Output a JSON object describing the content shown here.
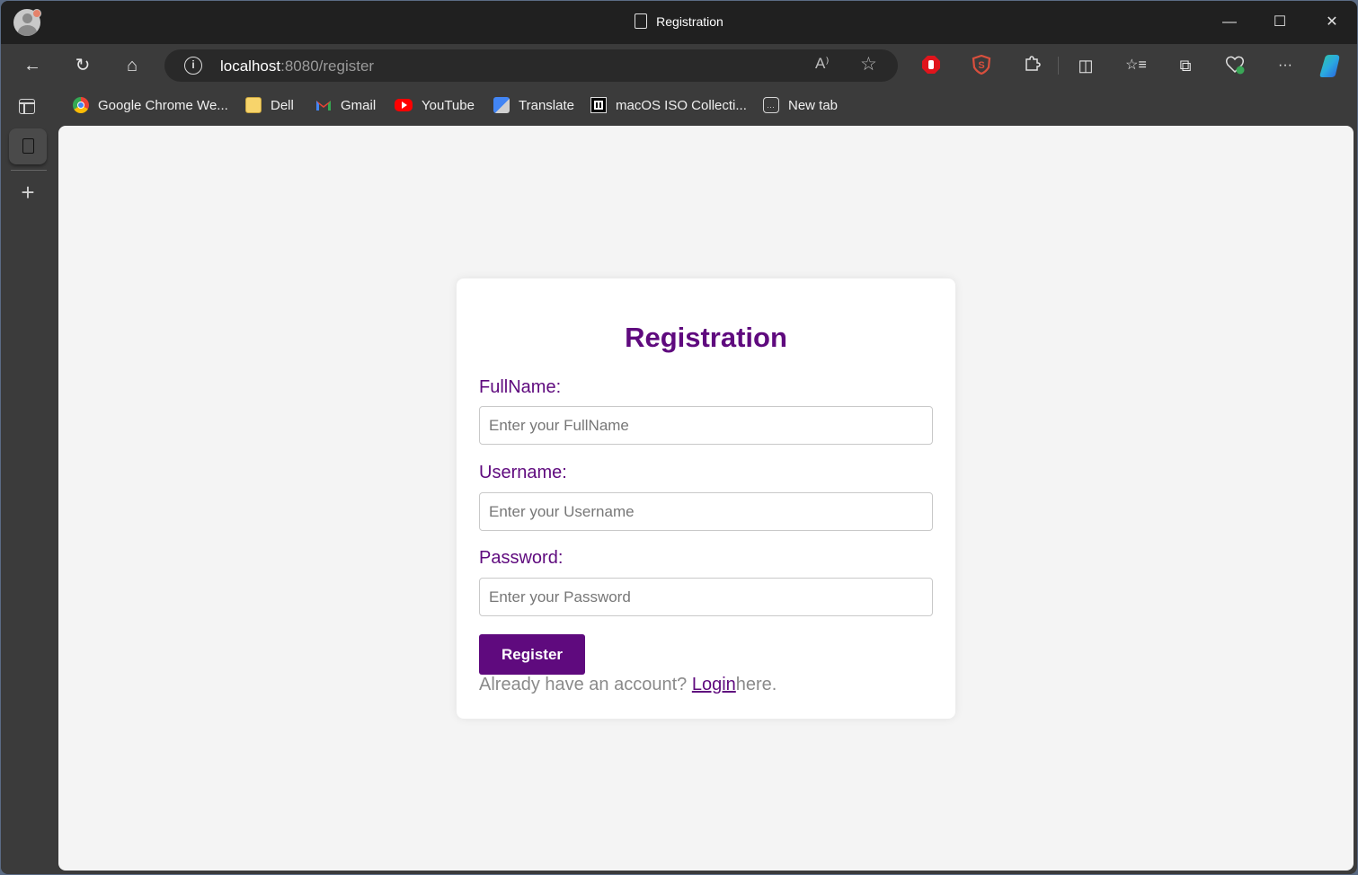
{
  "window": {
    "title": "Registration",
    "controls": {
      "minimize": "—",
      "maximize": "☐",
      "close": "✕"
    }
  },
  "toolbar": {
    "back_icon": "←",
    "refresh_icon": "↻",
    "home_icon": "⌂",
    "url_host": "localhost",
    "url_rest": ":8080/register",
    "read_aloud_icon": "A⁾",
    "favorite_icon": "☆",
    "split_icon": "◫",
    "favorites_icon": "☆≡",
    "collections_icon": "⧉",
    "more_icon": "···",
    "extension_colors": {
      "adblock": "#e0141c",
      "shield": "#d94f3d",
      "copilot": "#2aa9e0"
    }
  },
  "bookmarks": [
    {
      "label": "Google Chrome We...",
      "icon": "chrome-icon"
    },
    {
      "label": "Dell",
      "icon": "folder-icon"
    },
    {
      "label": "Gmail",
      "icon": "gmail-icon"
    },
    {
      "label": "YouTube",
      "icon": "youtube-icon"
    },
    {
      "label": "Translate",
      "icon": "translate-icon"
    },
    {
      "label": "macOS ISO Collecti...",
      "icon": "archive-icon"
    },
    {
      "label": "New tab",
      "icon": "new-tab-icon"
    }
  ],
  "sidebar": {
    "add_label": "+"
  },
  "form": {
    "title": "Registration",
    "fields": [
      {
        "label": "FullName:",
        "placeholder": "Enter your FullName",
        "value": ""
      },
      {
        "label": "Username:",
        "placeholder": "Enter your Username",
        "value": ""
      },
      {
        "label": "Password:",
        "placeholder": "Enter your Password",
        "value": ""
      }
    ],
    "submit_label": "Register",
    "footer_prefix": "Already have an account? ",
    "footer_link": "Login",
    "footer_suffix": "here."
  },
  "colors": {
    "accent": "#5f0a7e",
    "page_bg": "#f4f4f4",
    "card_bg": "#ffffff",
    "muted_text": "#8a8a8a"
  }
}
